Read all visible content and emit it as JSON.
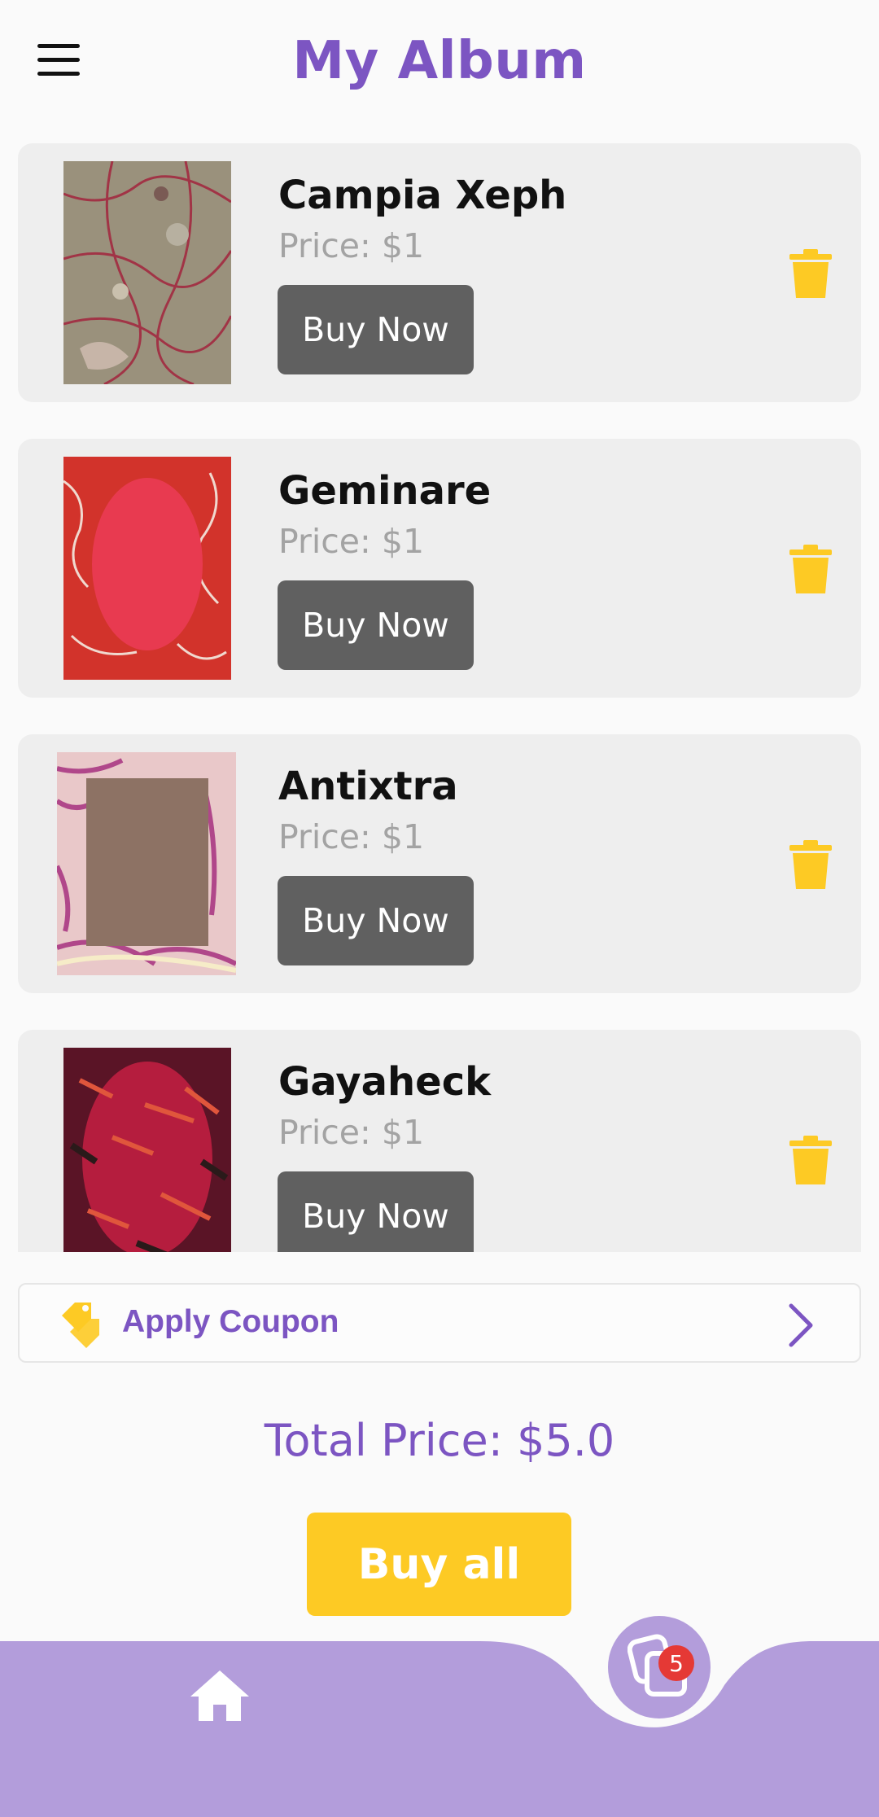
{
  "header": {
    "title": "My Album",
    "menu_icon": "hamburger-menu-icon"
  },
  "items": [
    {
      "name": "Campia Xeph",
      "price": "Price: $1",
      "button": "Buy Now",
      "thumb_colors": [
        "#9a8f7a",
        "#b03a48"
      ]
    },
    {
      "name": "Geminare",
      "price": "Price: $1",
      "button": "Buy Now",
      "thumb_colors": [
        "#d8352c",
        "#e8384f"
      ]
    },
    {
      "name": "Antixtra",
      "price": "Price: $1",
      "button": "Buy Now",
      "thumb_colors": [
        "#8c7264",
        "#c27ba0"
      ]
    },
    {
      "name": "Gayaheck",
      "price": "Price: $1",
      "button": "Buy Now",
      "thumb_colors": [
        "#7a1b2e",
        "#d8204a"
      ]
    }
  ],
  "coupon": {
    "label": "Apply Coupon",
    "icon": "tag-icon",
    "chevron": "chevron-right-icon"
  },
  "total": {
    "label": "Total Price: $5.0"
  },
  "buy_all": {
    "label": "Buy all"
  },
  "nav": {
    "home_icon": "home-icon",
    "album_icon": "album-icon",
    "badge_count": "5"
  },
  "colors": {
    "accent": "#7c55c2",
    "nav_bg": "#b39ddb",
    "yellow": "#fdca24",
    "button_dark": "#606060",
    "badge": "#e53935"
  }
}
